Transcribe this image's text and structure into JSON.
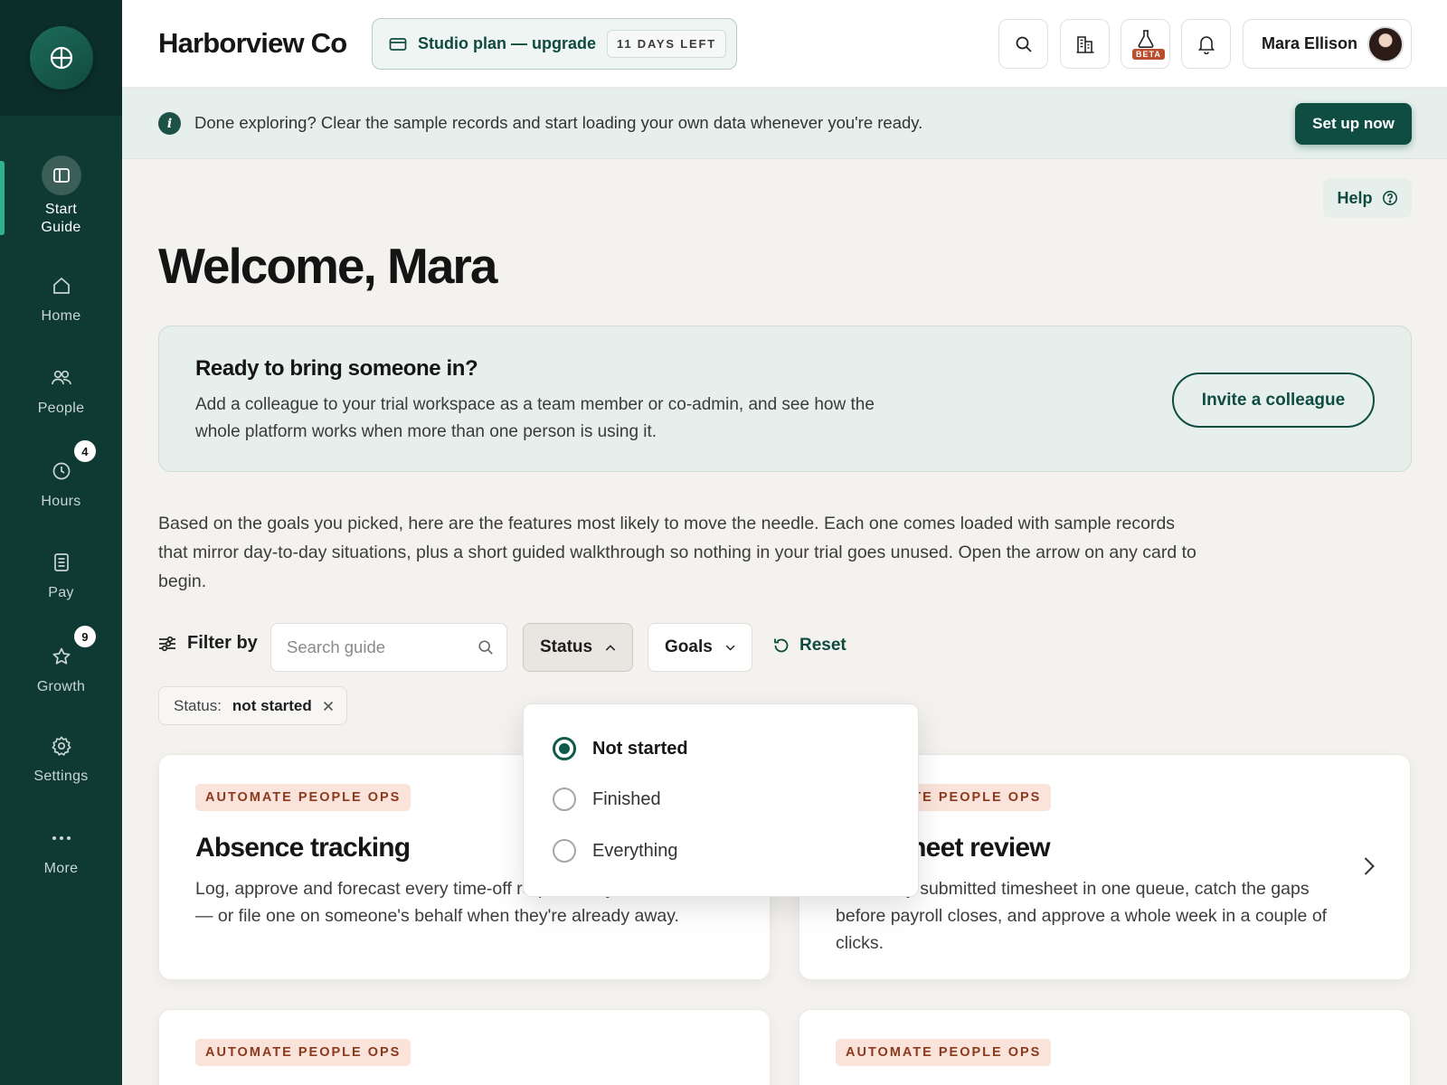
{
  "colors": {
    "sidebar": "#0f3a33",
    "accent": "#0f4d42",
    "tag_bg": "#fae3da",
    "tag_text": "#8c3a1d"
  },
  "sidebar": {
    "items": [
      {
        "label": "Start\nGuide",
        "icon": "layout-panel-icon",
        "active": true
      },
      {
        "label": "Home",
        "icon": "home-icon"
      },
      {
        "label": "People",
        "icon": "people-icon"
      },
      {
        "label": "Hours",
        "icon": "clock-icon",
        "badge": "4"
      },
      {
        "label": "Pay",
        "icon": "document-icon"
      },
      {
        "label": "Growth",
        "icon": "star-icon",
        "badge": "9"
      },
      {
        "label": "Settings",
        "icon": "gear-icon"
      },
      {
        "label": "More",
        "icon": "more-dots-icon"
      }
    ]
  },
  "header": {
    "brand": "Harborview Co",
    "plan_label": "Studio plan — upgrade",
    "days_left": "11 DAYS LEFT",
    "beta_label": "BETA",
    "user_name": "Mara Ellison"
  },
  "banner": {
    "text": "Done exploring? Clear the sample records and start loading your own data whenever you're ready.",
    "button": "Set up now"
  },
  "main": {
    "help": "Help",
    "welcome": "Welcome, Mara",
    "invite": {
      "title": "Ready to bring someone in?",
      "description": "Add a colleague to your trial workspace as a team member or co-admin, and see how the whole platform works when more than one person is using it.",
      "button": "Invite a colleague"
    },
    "intro": "Based on the goals you picked, here are the features most likely to move the needle. Each one comes loaded with sample records that mirror day-to-day situations, plus a short guided walkthrough so nothing in your trial goes unused. Open the arrow on any card to begin.",
    "filter": {
      "label": "Filter by",
      "search_placeholder": "Search guide",
      "status": "Status",
      "goals": "Goals",
      "reset": "Reset",
      "chip_key": "Status:",
      "chip_value": "not started"
    },
    "status_options": [
      {
        "label": "Not started",
        "selected": true
      },
      {
        "label": "Finished",
        "selected": false
      },
      {
        "label": "Everything",
        "selected": false
      }
    ],
    "cards": [
      {
        "tag": "AUTOMATE PEOPLE OPS",
        "title": "Absence tracking",
        "description": "Log, approve and forecast every time-off request for your team — or file one on someone's behalf when they're already away."
      },
      {
        "tag": "AUTOMATE PEOPLE OPS",
        "title": "Timesheet review",
        "description": "See every submitted timesheet in one queue, catch the gaps before payroll closes, and approve a whole week in a couple of clicks."
      },
      {
        "tag": "AUTOMATE PEOPLE OPS"
      },
      {
        "tag": "AUTOMATE PEOPLE OPS"
      }
    ]
  }
}
